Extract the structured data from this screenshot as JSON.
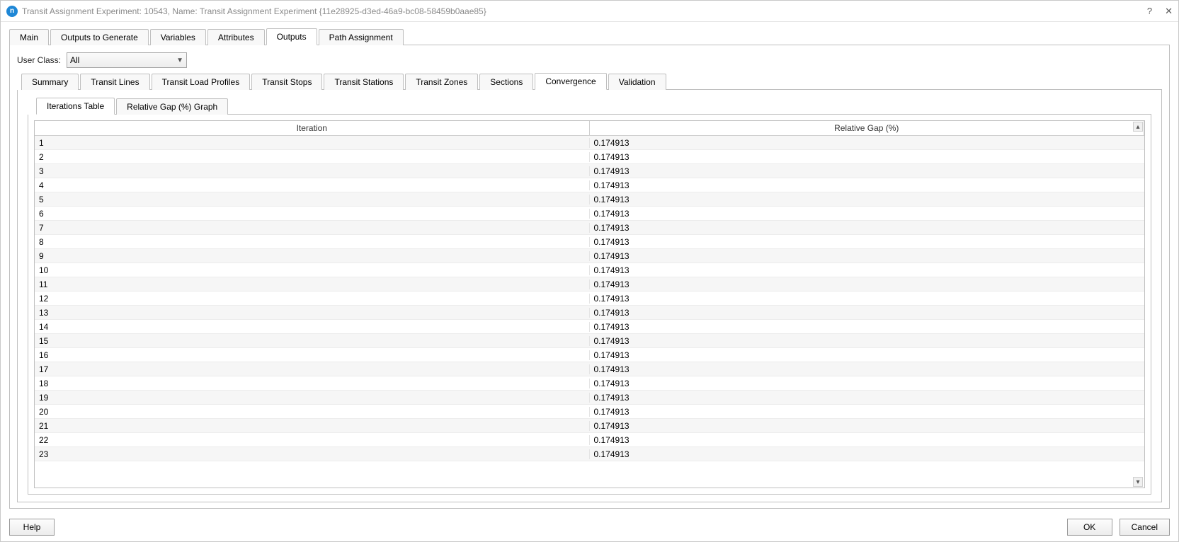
{
  "window": {
    "app_icon_letter": "n",
    "title": "Transit Assignment Experiment: 10543, Name: Transit Assignment Experiment {11e28925-d3ed-46a9-bc08-58459b0aae85}",
    "help_icon": "?",
    "close_icon": "✕"
  },
  "topTabs": [
    {
      "label": "Main",
      "active": false
    },
    {
      "label": "Outputs to Generate",
      "active": false
    },
    {
      "label": "Variables",
      "active": false
    },
    {
      "label": "Attributes",
      "active": false
    },
    {
      "label": "Outputs",
      "active": true
    },
    {
      "label": "Path Assignment",
      "active": false
    }
  ],
  "userClass": {
    "label": "User Class:",
    "value": "All"
  },
  "subTabs": [
    {
      "label": "Summary",
      "active": false
    },
    {
      "label": "Transit Lines",
      "active": false
    },
    {
      "label": "Transit Load Profiles",
      "active": false
    },
    {
      "label": "Transit Stops",
      "active": false
    },
    {
      "label": "Transit Stations",
      "active": false
    },
    {
      "label": "Transit Zones",
      "active": false
    },
    {
      "label": "Sections",
      "active": false
    },
    {
      "label": "Convergence",
      "active": true
    },
    {
      "label": "Validation",
      "active": false
    }
  ],
  "innerTabs": [
    {
      "label": "Iterations Table",
      "active": true
    },
    {
      "label": "Relative Gap (%) Graph",
      "active": false
    }
  ],
  "table": {
    "columns": [
      "Iteration",
      "Relative Gap (%)"
    ],
    "rows": [
      {
        "iter": "1",
        "gap": "0.174913"
      },
      {
        "iter": "2",
        "gap": "0.174913"
      },
      {
        "iter": "3",
        "gap": "0.174913"
      },
      {
        "iter": "4",
        "gap": "0.174913"
      },
      {
        "iter": "5",
        "gap": "0.174913"
      },
      {
        "iter": "6",
        "gap": "0.174913"
      },
      {
        "iter": "7",
        "gap": "0.174913"
      },
      {
        "iter": "8",
        "gap": "0.174913"
      },
      {
        "iter": "9",
        "gap": "0.174913"
      },
      {
        "iter": "10",
        "gap": "0.174913"
      },
      {
        "iter": "11",
        "gap": "0.174913"
      },
      {
        "iter": "12",
        "gap": "0.174913"
      },
      {
        "iter": "13",
        "gap": "0.174913"
      },
      {
        "iter": "14",
        "gap": "0.174913"
      },
      {
        "iter": "15",
        "gap": "0.174913"
      },
      {
        "iter": "16",
        "gap": "0.174913"
      },
      {
        "iter": "17",
        "gap": "0.174913"
      },
      {
        "iter": "18",
        "gap": "0.174913"
      },
      {
        "iter": "19",
        "gap": "0.174913"
      },
      {
        "iter": "20",
        "gap": "0.174913"
      },
      {
        "iter": "21",
        "gap": "0.174913"
      },
      {
        "iter": "22",
        "gap": "0.174913"
      },
      {
        "iter": "23",
        "gap": "0.174913"
      }
    ]
  },
  "footer": {
    "help": "Help",
    "ok": "OK",
    "cancel": "Cancel"
  }
}
